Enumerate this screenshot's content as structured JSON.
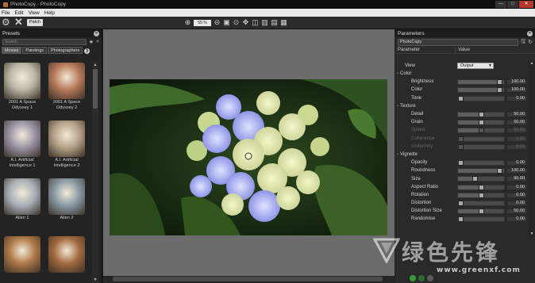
{
  "window": {
    "title": "PhotoCopy - PhotoCopy",
    "controls": [
      "—",
      "□",
      "✕"
    ]
  },
  "menu": [
    "File",
    "Edit",
    "View",
    "Help"
  ],
  "toolbar": {
    "patch_label": "Patch",
    "zoom_value": "55 %"
  },
  "presets_panel": {
    "title": "Presets",
    "search_placeholder": "Search",
    "tabs": [
      "Movies",
      "Paintings",
      "Photographers"
    ],
    "items": [
      {
        "label": "2001 A Space Odyssey 1",
        "tone": "#bcb6a4"
      },
      {
        "label": "2001 A Space Odyssey 2",
        "tone": "#b87a5a"
      },
      {
        "label": "A.I. Artificial Intelligence 1",
        "tone": "#9c94a6"
      },
      {
        "label": "A.I. Artificial Intelligence 2",
        "tone": "#b6a288"
      },
      {
        "label": "Alien 1",
        "tone": "#a8b0b8"
      },
      {
        "label": "Alien 2",
        "tone": "#8a9aa4"
      },
      {
        "label": "",
        "tone": "#b07a48"
      },
      {
        "label": "",
        "tone": "#a26a3e"
      }
    ]
  },
  "parameters_panel": {
    "title": "Parameters",
    "preset_name": "PhotoCopy",
    "col_parameter": "Parameter",
    "col_value": "Value",
    "view": {
      "label": "View",
      "value": "Output"
    },
    "rows": [
      {
        "kind": "group",
        "label": "Color"
      },
      {
        "kind": "item",
        "label": "Brightness",
        "value": "100.00",
        "level": 0.97,
        "dim": false
      },
      {
        "kind": "item",
        "label": "Color",
        "value": "100.00",
        "level": 0.97,
        "dim": false
      },
      {
        "kind": "item",
        "label": "Tone",
        "value": "0.00",
        "level": 0.0,
        "dim": false
      },
      {
        "kind": "group",
        "label": "Texture"
      },
      {
        "kind": "item",
        "label": "Detail",
        "value": "50.00",
        "level": 0.5,
        "dim": false
      },
      {
        "kind": "item",
        "label": "Grain",
        "value": "50.00",
        "level": 0.5,
        "dim": false
      },
      {
        "kind": "item",
        "label": "Speed",
        "value": "50.00",
        "level": 0.5,
        "dim": true
      },
      {
        "kind": "item",
        "label": "Coherence",
        "value": "0.00",
        "level": 0.0,
        "dim": true
      },
      {
        "kind": "item",
        "label": "Uniformity",
        "value": "0.00",
        "level": 0.0,
        "dim": true
      },
      {
        "kind": "group",
        "label": "Vignette"
      },
      {
        "kind": "item",
        "label": "Opacity",
        "value": "0.00",
        "level": 0.0,
        "dim": false
      },
      {
        "kind": "item",
        "label": "Roundness",
        "value": "100.00",
        "level": 0.97,
        "dim": false
      },
      {
        "kind": "item",
        "label": "Size",
        "value": "90.00",
        "level": 0.35,
        "dim": false
      },
      {
        "kind": "item",
        "label": "Aspect Ratio",
        "value": "0.00",
        "level": 0.5,
        "dim": false
      },
      {
        "kind": "item",
        "label": "Rotation",
        "value": "0.00",
        "level": 0.5,
        "dim": false
      },
      {
        "kind": "item",
        "label": "Distortion",
        "value": "0.00",
        "level": 0.0,
        "dim": false
      },
      {
        "kind": "item",
        "label": "Distortion Size",
        "value": "50.00",
        "level": 0.5,
        "dim": false
      },
      {
        "kind": "item",
        "label": "Randomise",
        "value": "0.00",
        "level": 0.0,
        "dim": false
      }
    ]
  },
  "watermark": {
    "text": "绿色先锋",
    "url": "www.greenxf.com"
  }
}
